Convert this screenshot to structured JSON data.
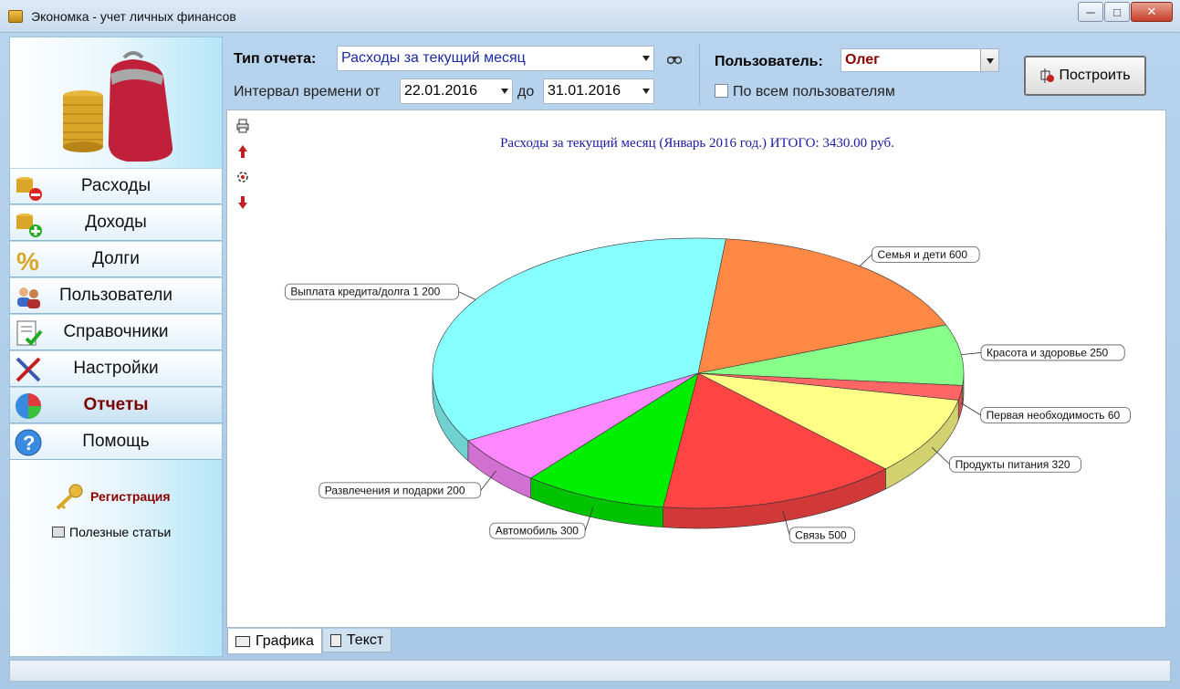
{
  "window": {
    "title": "Экономка - учет личных финансов"
  },
  "sidebar": {
    "items": [
      {
        "label": "Расходы",
        "icon": "coins-minus-icon"
      },
      {
        "label": "Доходы",
        "icon": "coins-plus-icon"
      },
      {
        "label": "Долги",
        "icon": "percent-icon"
      },
      {
        "label": "Пользователи",
        "icon": "users-icon"
      },
      {
        "label": "Справочники",
        "icon": "checklist-icon"
      },
      {
        "label": "Настройки",
        "icon": "tools-icon"
      },
      {
        "label": "Отчеты",
        "icon": "pie-chart-icon",
        "active": true
      },
      {
        "label": "Помощь",
        "icon": "help-icon"
      }
    ],
    "registration": "Регистрация",
    "articles": "Полезные статьи"
  },
  "controls": {
    "report_type_label": "Тип отчета:",
    "report_type_value": "Расходы за текущий месяц",
    "interval_label": "Интервал времени от",
    "date_from": "22.01.2016",
    "to_label": "до",
    "date_to": "31.01.2016",
    "user_label": "Пользователь:",
    "user_value": "Олег",
    "all_users_label": "По всем пользователям",
    "all_users_checked": false,
    "build_button": "Построить"
  },
  "tabs": {
    "graphics": "Графика",
    "text": "Текст",
    "active": "graphics"
  },
  "chart_data": {
    "type": "pie",
    "title": "Расходы за текущий месяц (Январь 2016 год.) ИТОГО: 3430.00 руб.",
    "slices": [
      {
        "label": "Семья и дети 600",
        "value": 600,
        "color": "#ff8844"
      },
      {
        "label": "Красота и здоровье 250",
        "value": 250,
        "color": "#88ff88"
      },
      {
        "label": "Первая необходимость 60",
        "value": 60,
        "color": "#ff6666"
      },
      {
        "label": "Продукты питания 320",
        "value": 320,
        "color": "#ffff88"
      },
      {
        "label": "Связь 500",
        "value": 500,
        "color": "#ff4444"
      },
      {
        "label": "Автомобиль 300",
        "value": 300,
        "color": "#00ee00"
      },
      {
        "label": "Развлечения и подарки 200",
        "value": 200,
        "color": "#ff88ff"
      },
      {
        "label": "Выплата кредита/долга 1 200",
        "value": 1200,
        "color": "#88ffff"
      }
    ]
  }
}
